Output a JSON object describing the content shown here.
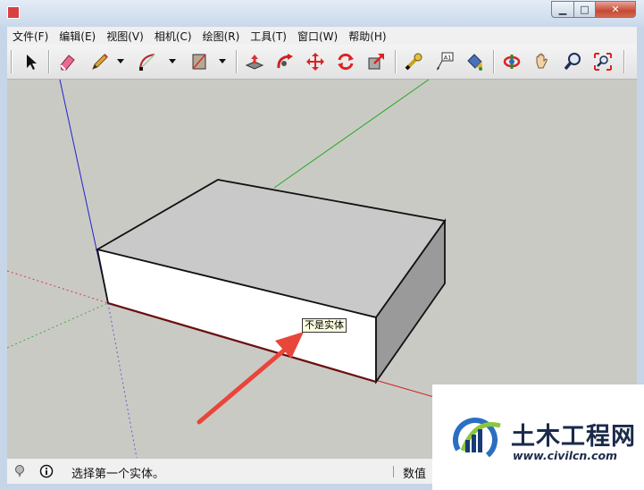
{
  "window": {
    "title": "",
    "minimize_glyph": "▁",
    "maximize_glyph": "□",
    "close_glyph": "✕"
  },
  "menu": [
    {
      "label": "文件(F)"
    },
    {
      "label": "编辑(E)"
    },
    {
      "label": "视图(V)"
    },
    {
      "label": "相机(C)"
    },
    {
      "label": "绘图(R)"
    },
    {
      "label": "工具(T)"
    },
    {
      "label": "窗口(W)"
    },
    {
      "label": "帮助(H)"
    }
  ],
  "toolbar": {
    "tools": [
      {
        "icon": "select-arrow-icon"
      },
      {
        "icon": "eraser-icon"
      },
      {
        "icon": "pencil-line-icon"
      },
      {
        "icon": "arc-icon"
      },
      {
        "icon": "rectangle-icon"
      },
      {
        "icon": "push-pull-icon"
      },
      {
        "icon": "follow-me-icon"
      },
      {
        "icon": "move-icon"
      },
      {
        "icon": "rotate-icon"
      },
      {
        "icon": "scale-icon"
      },
      {
        "icon": "tape-measure-icon"
      },
      {
        "icon": "text-label-icon"
      },
      {
        "icon": "paint-bucket-icon"
      },
      {
        "icon": "orbit-icon"
      },
      {
        "icon": "pan-hand-icon"
      },
      {
        "icon": "zoom-icon"
      },
      {
        "icon": "zoom-extents-icon"
      }
    ],
    "text_tool_label": "A1"
  },
  "viewport": {
    "tooltip": "不是实体",
    "axis_colors": {
      "red": "#cc2222",
      "green": "#22aa22",
      "blue": "#2222cc"
    },
    "face_colors": {
      "top": "#c9c9c9",
      "front": "#ffffff",
      "side": "#9a9a9a"
    },
    "arrow_color": "#e8463a",
    "background": "#cacac5"
  },
  "statusbar": {
    "hint": "选择第一个实体。",
    "measurements_label": "数值"
  },
  "watermark": {
    "name": "土木工程网",
    "url": "www.civilcn.com"
  }
}
